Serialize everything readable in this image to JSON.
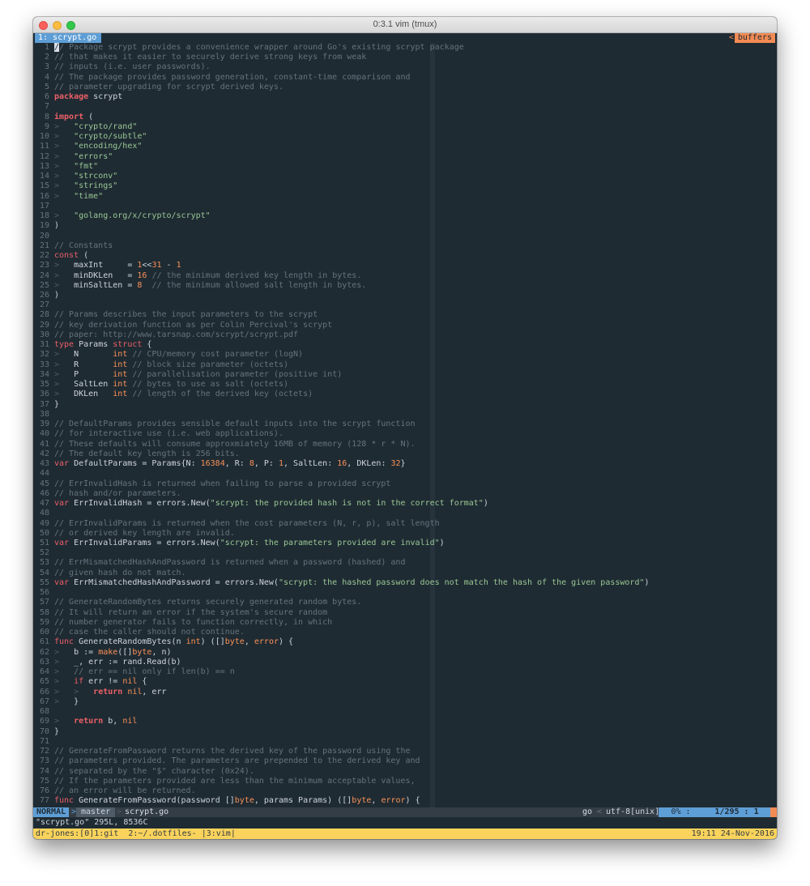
{
  "window": {
    "title": "0:3.1 vim (tmux)"
  },
  "tabline": {
    "active_tab": "1: scrypt.go",
    "buffers_label": "buffers",
    "buffers_arrow": "<"
  },
  "editor": {
    "lines": [
      {
        "n": "1",
        "segs": [
          [
            "/",
            "cursor"
          ],
          [
            "/ Package scrypt provides a convenience wrapper around Go's existing scrypt package",
            "c"
          ]
        ]
      },
      {
        "n": "2",
        "segs": [
          [
            "// that makes it easier to securely derive strong keys from weak",
            "c"
          ]
        ]
      },
      {
        "n": "3",
        "segs": [
          [
            "// inputs (i.e. user passwords).",
            "c"
          ]
        ]
      },
      {
        "n": "4",
        "segs": [
          [
            "// The package provides password generation, constant-time comparison and",
            "c"
          ]
        ]
      },
      {
        "n": "5",
        "segs": [
          [
            "// parameter upgrading for scrypt derived keys.",
            "c"
          ]
        ]
      },
      {
        "n": "6",
        "segs": [
          [
            "package",
            "k"
          ],
          [
            " scrypt",
            "t"
          ]
        ]
      },
      {
        "n": "7",
        "segs": []
      },
      {
        "n": "8",
        "segs": [
          [
            "import",
            "k"
          ],
          [
            " (",
            "t"
          ]
        ]
      },
      {
        "n": "9",
        "segs": [
          [
            ">   ",
            "l"
          ],
          [
            "\"crypto/rand\"",
            "s"
          ]
        ]
      },
      {
        "n": "10",
        "segs": [
          [
            ">   ",
            "l"
          ],
          [
            "\"crypto/subtle\"",
            "s"
          ]
        ]
      },
      {
        "n": "11",
        "segs": [
          [
            ">   ",
            "l"
          ],
          [
            "\"encoding/hex\"",
            "s"
          ]
        ]
      },
      {
        "n": "12",
        "segs": [
          [
            ">   ",
            "l"
          ],
          [
            "\"errors\"",
            "s"
          ]
        ]
      },
      {
        "n": "13",
        "segs": [
          [
            ">   ",
            "l"
          ],
          [
            "\"fmt\"",
            "s"
          ]
        ]
      },
      {
        "n": "14",
        "segs": [
          [
            ">   ",
            "l"
          ],
          [
            "\"strconv\"",
            "s"
          ]
        ]
      },
      {
        "n": "15",
        "segs": [
          [
            ">   ",
            "l"
          ],
          [
            "\"strings\"",
            "s"
          ]
        ]
      },
      {
        "n": "16",
        "segs": [
          [
            ">   ",
            "l"
          ],
          [
            "\"time\"",
            "s"
          ]
        ]
      },
      {
        "n": "17",
        "segs": []
      },
      {
        "n": "18",
        "segs": [
          [
            ">   ",
            "l"
          ],
          [
            "\"golang.org/x/crypto/scrypt\"",
            "s"
          ]
        ]
      },
      {
        "n": "19",
        "segs": [
          [
            ")",
            "t"
          ]
        ]
      },
      {
        "n": "20",
        "segs": []
      },
      {
        "n": "21",
        "segs": [
          [
            "// Constants",
            "c"
          ]
        ]
      },
      {
        "n": "22",
        "segs": [
          [
            "const",
            "kn"
          ],
          [
            " (",
            "t"
          ]
        ]
      },
      {
        "n": "23",
        "segs": [
          [
            ">   ",
            "l"
          ],
          [
            "maxInt     = ",
            "t"
          ],
          [
            "1",
            "num"
          ],
          [
            "<<",
            "t"
          ],
          [
            "31",
            "num"
          ],
          [
            " - ",
            "t"
          ],
          [
            "1",
            "num"
          ]
        ]
      },
      {
        "n": "24",
        "segs": [
          [
            ">   ",
            "l"
          ],
          [
            "minDKLen   = ",
            "t"
          ],
          [
            "16",
            "num"
          ],
          [
            " // the minimum derived key length in bytes.",
            "c"
          ]
        ]
      },
      {
        "n": "25",
        "segs": [
          [
            ">   ",
            "l"
          ],
          [
            "minSaltLen = ",
            "t"
          ],
          [
            "8",
            "num"
          ],
          [
            "  // the minimum allowed salt length in bytes.",
            "c"
          ]
        ]
      },
      {
        "n": "26",
        "segs": [
          [
            ")",
            "t"
          ]
        ]
      },
      {
        "n": "27",
        "segs": []
      },
      {
        "n": "28",
        "segs": [
          [
            "// Params describes the input parameters to the scrypt",
            "c"
          ]
        ]
      },
      {
        "n": "29",
        "segs": [
          [
            "// key derivation function as per Colin Percival's scrypt",
            "c"
          ]
        ]
      },
      {
        "n": "30",
        "segs": [
          [
            "// paper: http://www.tarsnap.com/scrypt/scrypt.pdf",
            "c"
          ]
        ]
      },
      {
        "n": "31",
        "segs": [
          [
            "type",
            "kn"
          ],
          [
            " Params ",
            "t"
          ],
          [
            "struct",
            "kn"
          ],
          [
            " {",
            "t"
          ]
        ]
      },
      {
        "n": "32",
        "segs": [
          [
            ">   ",
            "l"
          ],
          [
            "N       ",
            "t"
          ],
          [
            "int",
            "ty"
          ],
          [
            " // CPU/memory cost parameter (logN)",
            "c"
          ]
        ]
      },
      {
        "n": "33",
        "segs": [
          [
            ">   ",
            "l"
          ],
          [
            "R       ",
            "t"
          ],
          [
            "int",
            "ty"
          ],
          [
            " // block size parameter (octets)",
            "c"
          ]
        ]
      },
      {
        "n": "34",
        "segs": [
          [
            ">   ",
            "l"
          ],
          [
            "P       ",
            "t"
          ],
          [
            "int",
            "ty"
          ],
          [
            " // parallelisation parameter (positive int)",
            "c"
          ]
        ]
      },
      {
        "n": "35",
        "segs": [
          [
            ">   ",
            "l"
          ],
          [
            "SaltLen ",
            "t"
          ],
          [
            "int",
            "ty"
          ],
          [
            " // bytes to use as salt (octets)",
            "c"
          ]
        ]
      },
      {
        "n": "36",
        "segs": [
          [
            ">   ",
            "l"
          ],
          [
            "DKLen   ",
            "t"
          ],
          [
            "int",
            "ty"
          ],
          [
            " // length of the derived key (octets)",
            "c"
          ]
        ]
      },
      {
        "n": "37",
        "segs": [
          [
            "}",
            "t"
          ]
        ]
      },
      {
        "n": "38",
        "segs": []
      },
      {
        "n": "39",
        "segs": [
          [
            "// DefaultParams provides sensible default inputs into the scrypt function",
            "c"
          ]
        ]
      },
      {
        "n": "40",
        "segs": [
          [
            "// for interactive use (i.e. web applications).",
            "c"
          ]
        ]
      },
      {
        "n": "41",
        "segs": [
          [
            "// These defaults will consume approxmiately 16MB of memory (128 * r * N).",
            "c"
          ]
        ]
      },
      {
        "n": "42",
        "segs": [
          [
            "// The default key length is 256 bits.",
            "c"
          ]
        ]
      },
      {
        "n": "43",
        "segs": [
          [
            "var",
            "kn"
          ],
          [
            " DefaultParams = Params{N: ",
            "t"
          ],
          [
            "16384",
            "num"
          ],
          [
            ", R: ",
            "t"
          ],
          [
            "8",
            "num"
          ],
          [
            ", P: ",
            "t"
          ],
          [
            "1",
            "num"
          ],
          [
            ", SaltLen: ",
            "t"
          ],
          [
            "16",
            "num"
          ],
          [
            ", DKLen: ",
            "t"
          ],
          [
            "32",
            "num"
          ],
          [
            "}",
            "t"
          ]
        ]
      },
      {
        "n": "44",
        "segs": []
      },
      {
        "n": "45",
        "segs": [
          [
            "// ErrInvalidHash is returned when failing to parse a provided scrypt",
            "c"
          ]
        ]
      },
      {
        "n": "46",
        "segs": [
          [
            "// hash and/or parameters.",
            "c"
          ]
        ]
      },
      {
        "n": "47",
        "segs": [
          [
            "var",
            "kn"
          ],
          [
            " ErrInvalidHash = errors.New(",
            "t"
          ],
          [
            "\"scrypt: the provided hash is not in the correct format\"",
            "s"
          ],
          [
            ")",
            "t"
          ]
        ]
      },
      {
        "n": "48",
        "segs": []
      },
      {
        "n": "49",
        "segs": [
          [
            "// ErrInvalidParams is returned when the cost parameters (N, r, p), salt length",
            "c"
          ]
        ]
      },
      {
        "n": "50",
        "segs": [
          [
            "// or derived key length are invalid.",
            "c"
          ]
        ]
      },
      {
        "n": "51",
        "segs": [
          [
            "var",
            "kn"
          ],
          [
            " ErrInvalidParams = errors.New(",
            "t"
          ],
          [
            "\"scrypt: the parameters provided are invalid\"",
            "s"
          ],
          [
            ")",
            "t"
          ]
        ]
      },
      {
        "n": "52",
        "segs": []
      },
      {
        "n": "53",
        "segs": [
          [
            "// ErrMismatchedHashAndPassword is returned when a password (hashed) and",
            "c"
          ]
        ]
      },
      {
        "n": "54",
        "segs": [
          [
            "// given hash do not match.",
            "c"
          ]
        ]
      },
      {
        "n": "55",
        "segs": [
          [
            "var",
            "kn"
          ],
          [
            " ErrMismatchedHashAndPassword = errors.New(",
            "t"
          ],
          [
            "\"scrypt: the hashed password does not match the hash of the given password\"",
            "s"
          ],
          [
            ")",
            "t"
          ]
        ]
      },
      {
        "n": "56",
        "segs": []
      },
      {
        "n": "57",
        "segs": [
          [
            "// GenerateRandomBytes returns securely generated random bytes.",
            "c"
          ]
        ]
      },
      {
        "n": "58",
        "segs": [
          [
            "// It will return an error if the system's secure random",
            "c"
          ]
        ]
      },
      {
        "n": "59",
        "segs": [
          [
            "// number generator fails to function correctly, in which",
            "c"
          ]
        ]
      },
      {
        "n": "60",
        "segs": [
          [
            "// case the caller should not continue.",
            "c"
          ]
        ]
      },
      {
        "n": "61",
        "segs": [
          [
            "func",
            "kn"
          ],
          [
            " GenerateRandomBytes(n ",
            "t"
          ],
          [
            "int",
            "ty"
          ],
          [
            ") ([]",
            "t"
          ],
          [
            "byte",
            "ty"
          ],
          [
            ", ",
            "t"
          ],
          [
            "error",
            "ty"
          ],
          [
            ") {",
            "t"
          ]
        ]
      },
      {
        "n": "62",
        "segs": [
          [
            ">   ",
            "l"
          ],
          [
            "b := ",
            "t"
          ],
          [
            "make",
            "ty"
          ],
          [
            "([]",
            "t"
          ],
          [
            "byte",
            "ty"
          ],
          [
            ", n)",
            "t"
          ]
        ]
      },
      {
        "n": "63",
        "segs": [
          [
            ">   ",
            "l"
          ],
          [
            "_, err := rand.Read(b)",
            "t"
          ]
        ]
      },
      {
        "n": "64",
        "segs": [
          [
            ">   ",
            "l"
          ],
          [
            "// err == nil only if len(b) == n",
            "c"
          ]
        ]
      },
      {
        "n": "65",
        "segs": [
          [
            ">   ",
            "l"
          ],
          [
            "if",
            "kn"
          ],
          [
            " err != ",
            "t"
          ],
          [
            "nil",
            "num"
          ],
          [
            " {",
            "t"
          ]
        ]
      },
      {
        "n": "66",
        "segs": [
          [
            ">   >   ",
            "l"
          ],
          [
            "return",
            "k"
          ],
          [
            " ",
            "t"
          ],
          [
            "nil",
            "num"
          ],
          [
            ", err",
            "t"
          ]
        ]
      },
      {
        "n": "67",
        "segs": [
          [
            ">   ",
            "l"
          ],
          [
            "}",
            "t"
          ]
        ]
      },
      {
        "n": "68",
        "segs": []
      },
      {
        "n": "69",
        "segs": [
          [
            ">   ",
            "l"
          ],
          [
            "return",
            "k"
          ],
          [
            " b, ",
            "t"
          ],
          [
            "nil",
            "num"
          ]
        ]
      },
      {
        "n": "70",
        "segs": [
          [
            "}",
            "t"
          ]
        ]
      },
      {
        "n": "71",
        "segs": []
      },
      {
        "n": "72",
        "segs": [
          [
            "// GenerateFromPassword returns the derived key of the password using the",
            "c"
          ]
        ]
      },
      {
        "n": "73",
        "segs": [
          [
            "// parameters provided. The parameters are prepended to the derived key and",
            "c"
          ]
        ]
      },
      {
        "n": "74",
        "segs": [
          [
            "// separated by the \"$\" character (0x24).",
            "c"
          ]
        ]
      },
      {
        "n": "75",
        "segs": [
          [
            "// If the parameters provided are less than the minimum acceptable values,",
            "c"
          ]
        ]
      },
      {
        "n": "76",
        "segs": [
          [
            "// an error will be returned.",
            "c"
          ]
        ]
      },
      {
        "n": "77",
        "segs": [
          [
            "func",
            "kn"
          ],
          [
            " GenerateFromPassword(password []",
            "t"
          ],
          [
            "byte",
            "ty"
          ],
          [
            ", params Params) ([]",
            "t"
          ],
          [
            "byte",
            "ty"
          ],
          [
            ", ",
            "t"
          ],
          [
            "error",
            "ty"
          ],
          [
            ") {",
            "t"
          ]
        ]
      }
    ]
  },
  "statusline": {
    "mode": "NORMAL",
    "branch": "master",
    "filename": "scrypt.go",
    "filetype": "go",
    "encoding": "utf-8[unix]",
    "percent": "0% :",
    "position": "1/295 :  1",
    "sep": ">",
    "sep_left": "<"
  },
  "cmdline": {
    "text": "\"scrypt.go\" 295L, 8536C"
  },
  "tmux": {
    "left": "dr-jones:[0]1:git  2:~/.dotfiles- |3:vim|",
    "right": "19:11 24-Nov-2016"
  },
  "colors": {
    "background": "#1f2b33",
    "comment": "#65737e",
    "keyword": "#ec5f67",
    "string": "#99c794",
    "number": "#f99157",
    "accent_blue": "#5e9ed6",
    "accent_orange": "#f28b54",
    "tmux_yellow": "#f9d35b"
  }
}
